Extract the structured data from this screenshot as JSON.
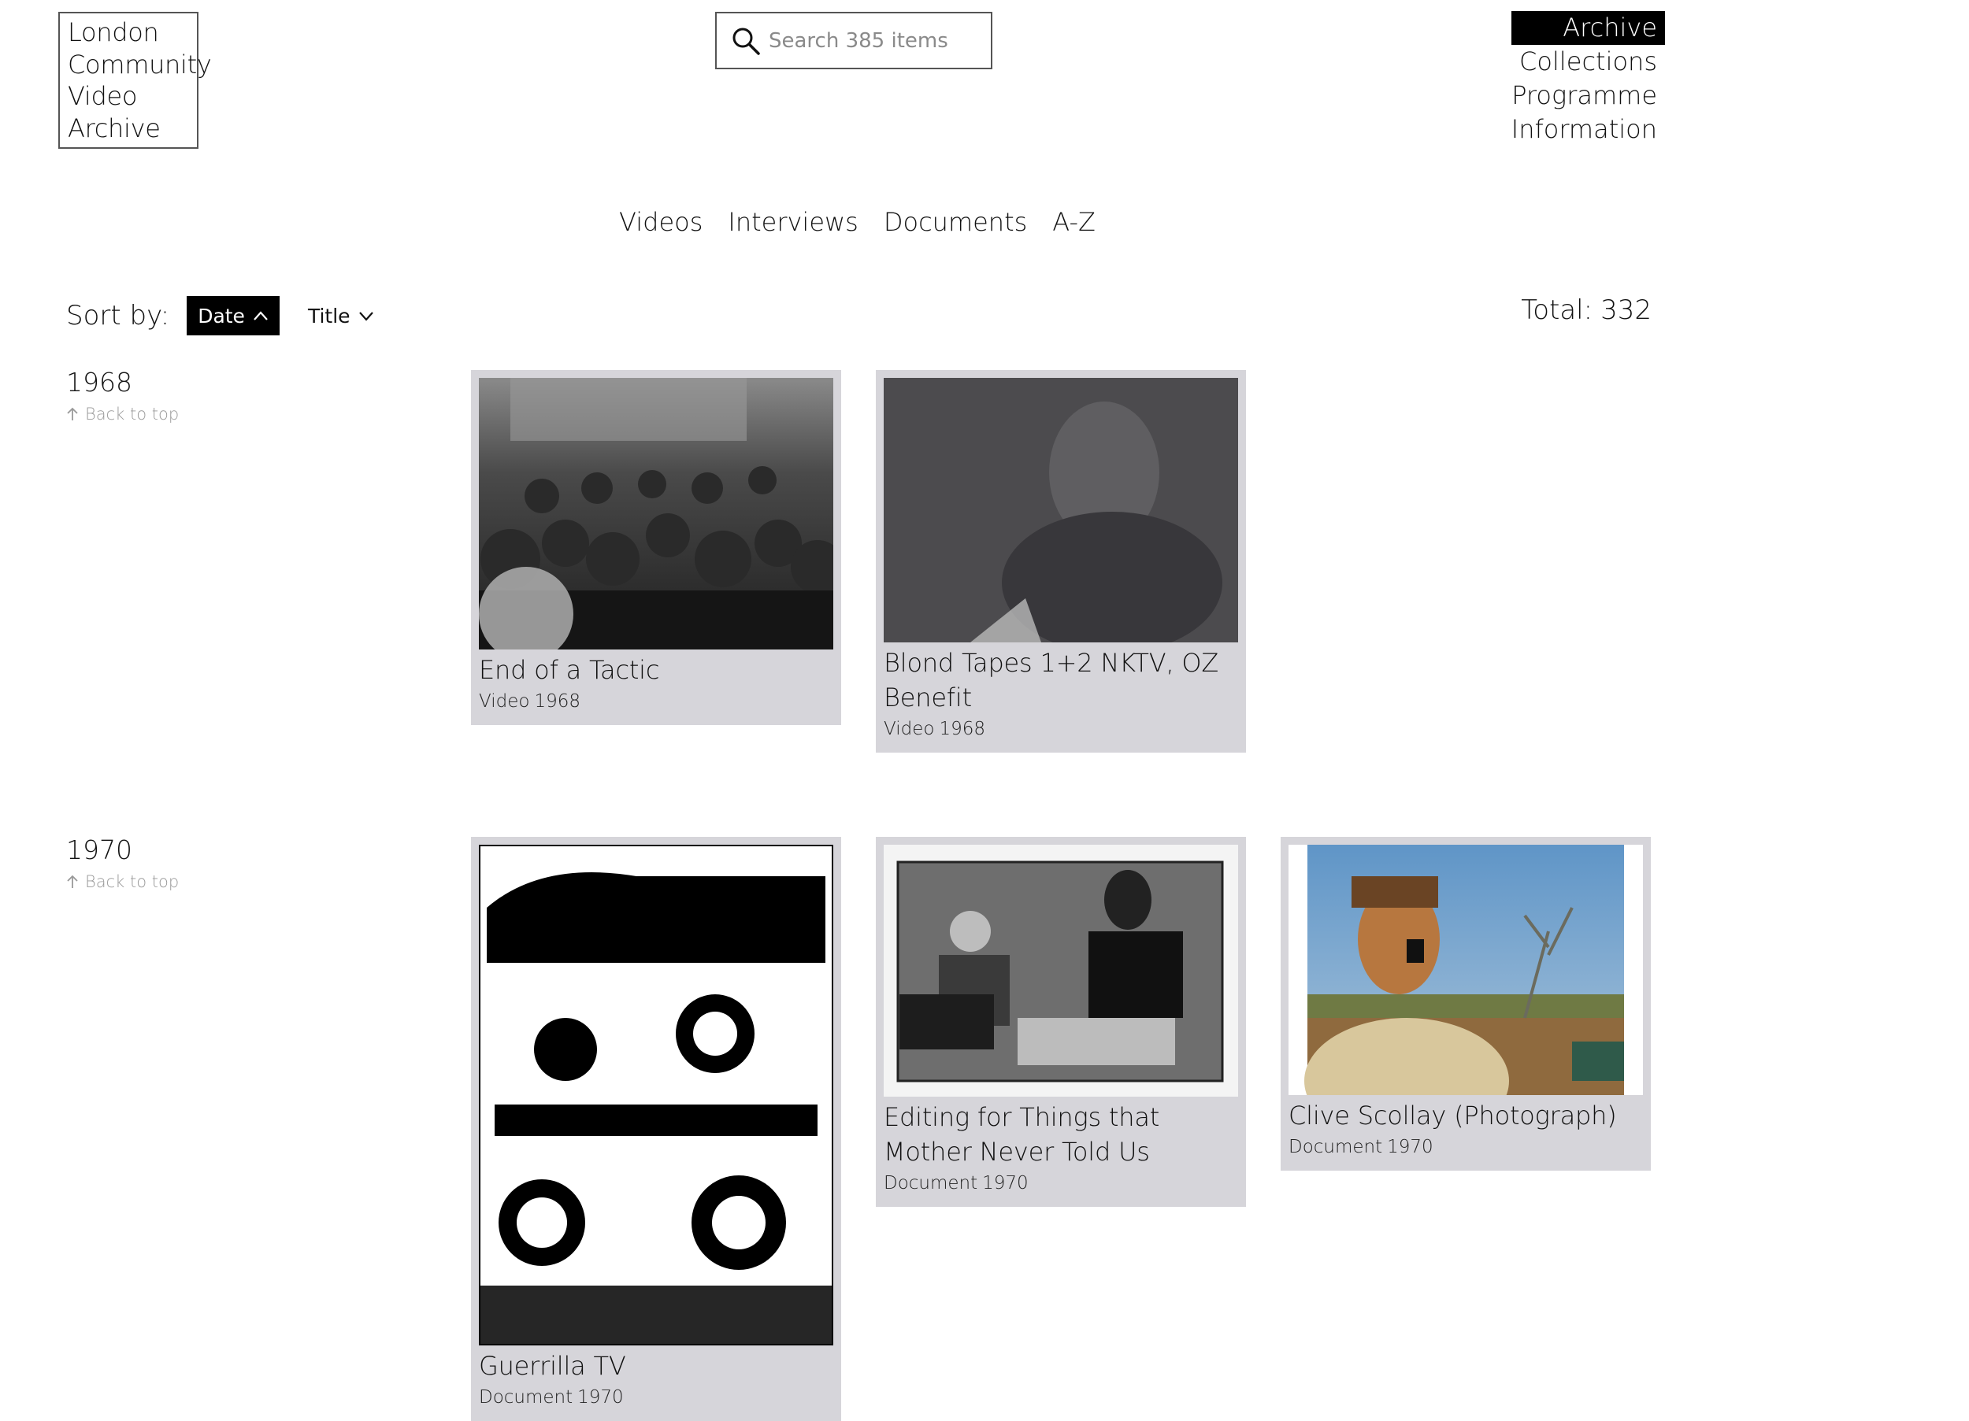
{
  "logo": {
    "lines": [
      "London",
      "Community",
      "Video",
      "Archive"
    ]
  },
  "search": {
    "placeholder": "Search 385 items",
    "icon": "search-icon"
  },
  "topnav": {
    "items": [
      "Archive",
      "Collections",
      "Programme",
      "Information"
    ],
    "active": "Archive"
  },
  "tabs": [
    "Videos",
    "Interviews",
    "Documents",
    "A-Z"
  ],
  "sort": {
    "label": "Sort by:",
    "options": [
      {
        "label": "Date",
        "icon": "chevron-up-icon",
        "active": true
      },
      {
        "label": "Title",
        "icon": "chevron-down-icon",
        "active": false
      }
    ]
  },
  "total": {
    "label": "Total:",
    "value": "332"
  },
  "back_to_top": "Back to top",
  "years": [
    {
      "year": "1968",
      "items": [
        {
          "title": "End of a Tactic",
          "type": "Video",
          "year": "1968"
        },
        {
          "title": "Blond Tapes 1+2 NKTV, OZ Benefit",
          "type": "Video",
          "year": "1968"
        }
      ]
    },
    {
      "year": "1970",
      "items": [
        {
          "title": "Guerrilla TV",
          "type": "Document",
          "year": "1970"
        },
        {
          "title": "Editing for Things that Mother Never Told Us",
          "type": "Document",
          "year": "1970"
        },
        {
          "title": "Clive Scollay (Photograph)",
          "type": "Document",
          "year": "1970"
        }
      ]
    }
  ],
  "colors": {
    "card_bg": "#d6d5da",
    "active_bg": "#000000",
    "muted_text": "#999999"
  }
}
